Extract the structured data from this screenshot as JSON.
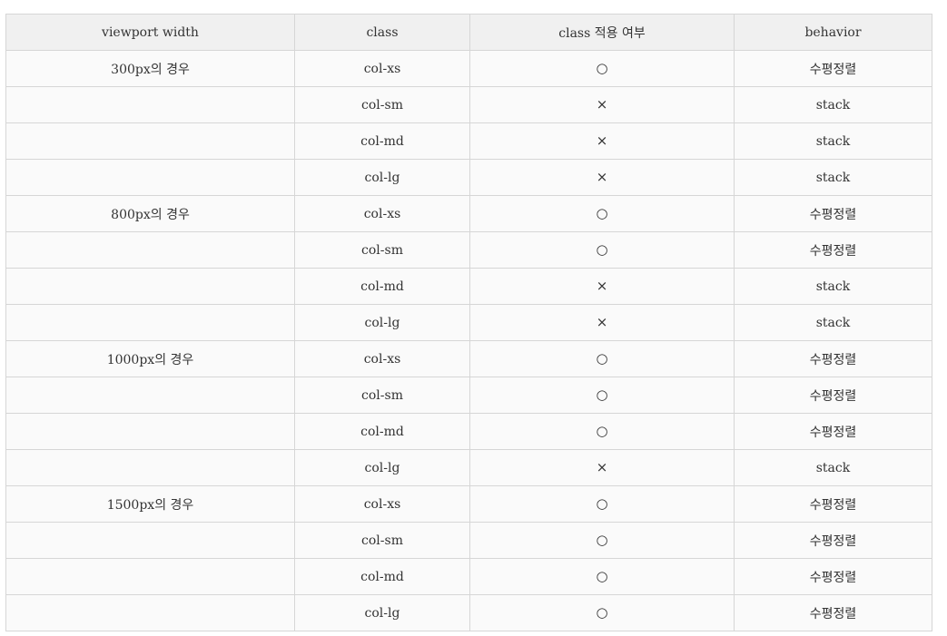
{
  "table": {
    "headers": [
      "viewport width",
      "class",
      "class 적용 여부",
      "behavior"
    ],
    "rows": [
      [
        "300px의 경우",
        "col-xs",
        "○",
        "수평정렬"
      ],
      [
        "",
        "col-sm",
        "×",
        "stack"
      ],
      [
        "",
        "col-md",
        "×",
        "stack"
      ],
      [
        "",
        "col-lg",
        "×",
        "stack"
      ],
      [
        "800px의 경우",
        "col-xs",
        "○",
        "수평정렬"
      ],
      [
        "",
        "col-sm",
        "○",
        "수평정렬"
      ],
      [
        "",
        "col-md",
        "×",
        "stack"
      ],
      [
        "",
        "col-lg",
        "×",
        "stack"
      ],
      [
        "1000px의 경우",
        "col-xs",
        "○",
        "수평정렬"
      ],
      [
        "",
        "col-sm",
        "○",
        "수평정렬"
      ],
      [
        "",
        "col-md",
        "○",
        "수평정렬"
      ],
      [
        "",
        "col-lg",
        "×",
        "stack"
      ],
      [
        "1500px의 경우",
        "col-xs",
        "○",
        "수평정렬"
      ],
      [
        "",
        "col-sm",
        "○",
        "수평정렬"
      ],
      [
        "",
        "col-md",
        "○",
        "수평정렬"
      ],
      [
        "",
        "col-lg",
        "○",
        "수평정렬"
      ]
    ]
  }
}
